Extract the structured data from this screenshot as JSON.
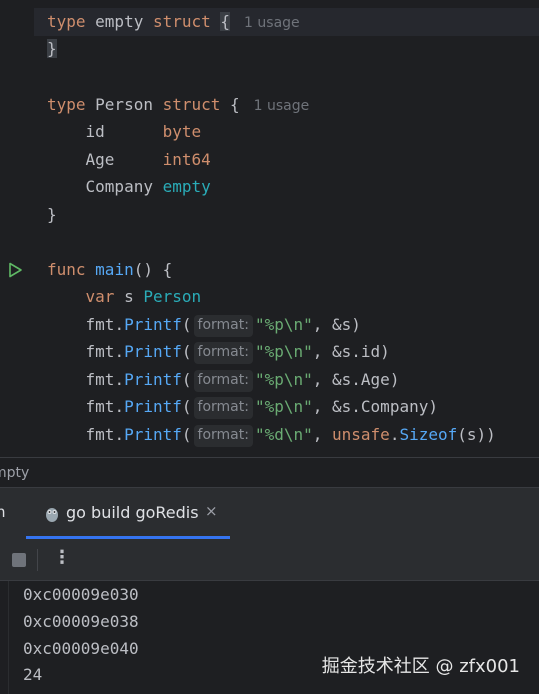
{
  "editor": {
    "line1": {
      "kw1": "type",
      "name": " empty ",
      "kw2": "struct",
      "brace": "{",
      "usage": "1 usage"
    },
    "line2": {
      "brace": "}"
    },
    "line4": {
      "kw1": "type",
      "name": " Person ",
      "kw2": "struct",
      "brace": " {",
      "usage": "1 usage"
    },
    "fields": [
      {
        "name": "id      ",
        "type": "byte"
      },
      {
        "name": "Age     ",
        "type": "int64"
      },
      {
        "name": "Company ",
        "type": "empty"
      }
    ],
    "line8": {
      "brace": "}"
    },
    "line10": {
      "kw": "func",
      "fn": "main",
      "rest": "() {"
    },
    "line11": {
      "kw": "var",
      "mid": " s ",
      "type": "Person"
    },
    "printf_calls": [
      {
        "pkg": "fmt",
        "method": "Printf",
        "hint": "format:",
        "fmt": "\"%p\\n\"",
        "arg": ", &s)"
      },
      {
        "pkg": "fmt",
        "method": "Printf",
        "hint": "format:",
        "fmt": "\"%p\\n\"",
        "arg": ", &s.id)"
      },
      {
        "pkg": "fmt",
        "method": "Printf",
        "hint": "format:",
        "fmt": "\"%p\\n\"",
        "arg": ", &s.Age)"
      },
      {
        "pkg": "fmt",
        "method": "Printf",
        "hint": "format:",
        "fmt": "\"%p\\n\"",
        "arg": ", &s.Company)"
      },
      {
        "pkg": "fmt",
        "method": "Printf",
        "hint": "format:",
        "fmt": "\"%d\\n\"",
        "arg_pre": ", ",
        "unsafe": "unsafe",
        "dot": ".",
        "sizeof": "Sizeof",
        "arg_post": "(s))"
      }
    ]
  },
  "breadcrumb": "mpty",
  "run_panel": {
    "left_tab": "n",
    "tab_label": "go build goRedis",
    "close_glyph": "×",
    "more_glyph": "⋮"
  },
  "console": {
    "lines": [
      "0xc00009e030",
      "0xc00009e038",
      "0xc00009e040",
      "24"
    ]
  },
  "watermark": "掘金技术社区 @ zfx001",
  "colors": {
    "accent": "#3574f0",
    "keyword": "#cf8e6d",
    "function": "#56a8f5",
    "type": "#2aacb8",
    "string": "#6aab73",
    "run_icon": "#5fb865"
  }
}
